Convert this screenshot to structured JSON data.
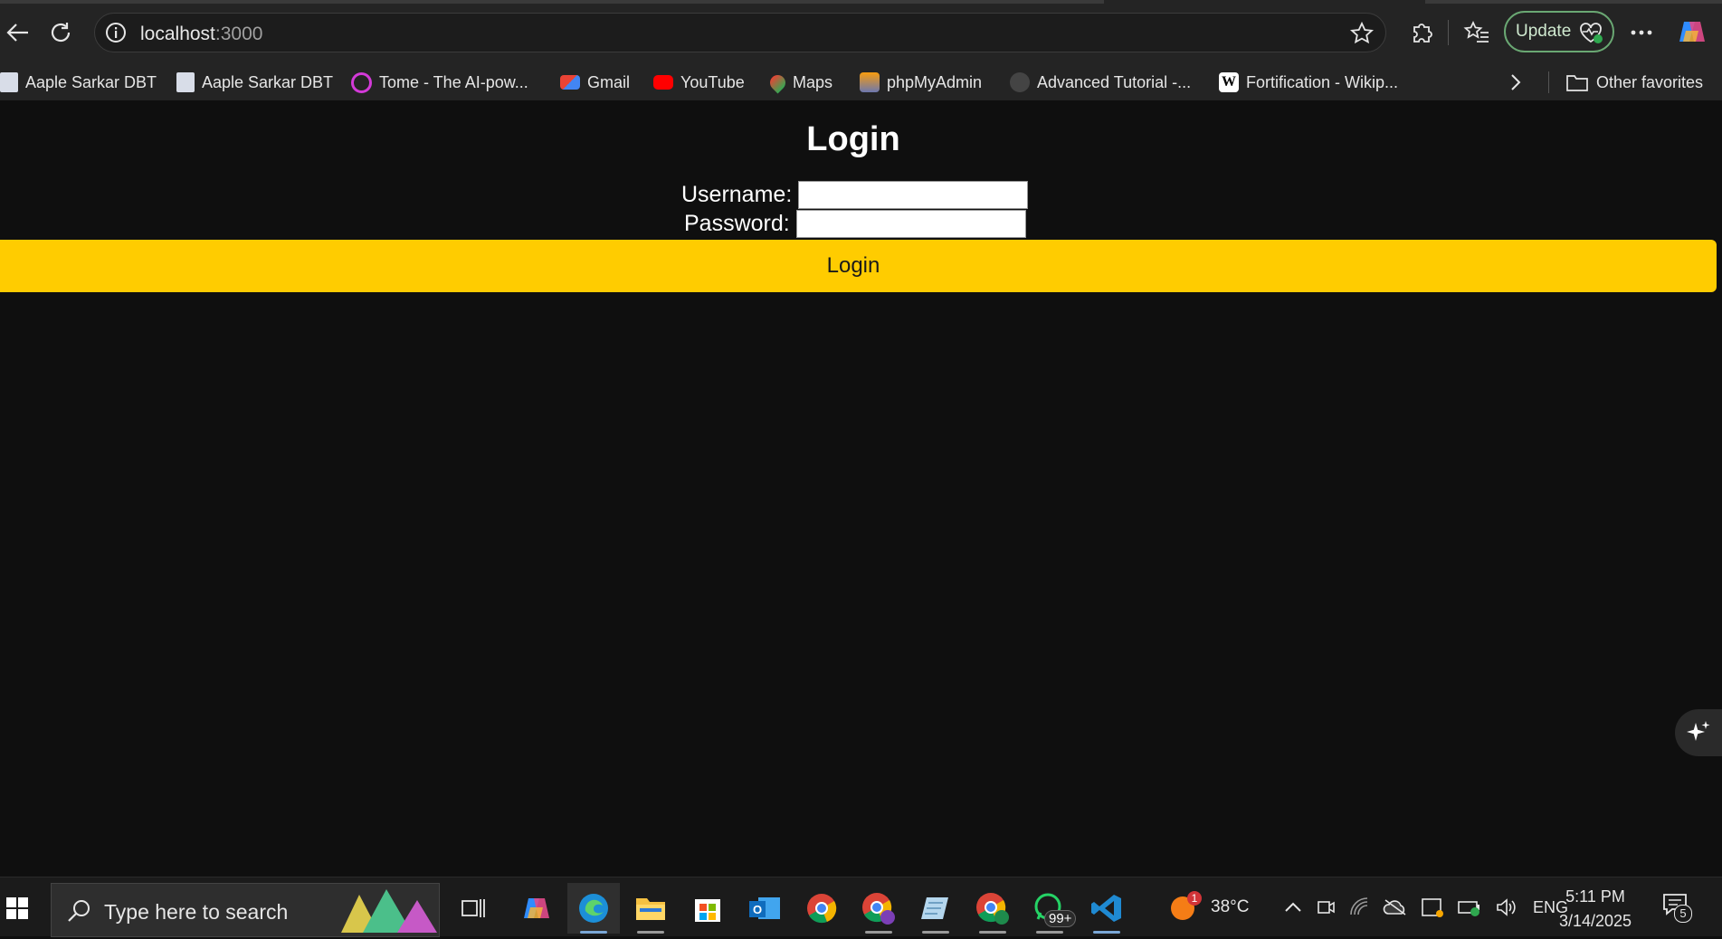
{
  "browser": {
    "url_host": "localhost",
    "url_port": ":3000",
    "update_label": "Update",
    "bookmarks": [
      {
        "label": "Aaple Sarkar DBT",
        "icon": "document-icon"
      },
      {
        "label": "Aaple Sarkar DBT",
        "icon": "document-icon"
      },
      {
        "label": "Tome - The AI-pow...",
        "icon": "tome-icon"
      },
      {
        "label": "Gmail",
        "icon": "gmail-icon"
      },
      {
        "label": "YouTube",
        "icon": "youtube-icon"
      },
      {
        "label": "Maps",
        "icon": "maps-icon"
      },
      {
        "label": "phpMyAdmin",
        "icon": "phpmyadmin-icon"
      },
      {
        "label": "Advanced Tutorial -...",
        "icon": "tutorial-icon"
      },
      {
        "label": "Fortification - Wikip...",
        "icon": "wikipedia-icon"
      }
    ],
    "other_favorites": "Other favorites"
  },
  "page": {
    "title": "Login",
    "username_label": "Username:",
    "password_label": "Password:",
    "login_button": "Login"
  },
  "taskbar": {
    "search_placeholder": "Type here to search",
    "whatsapp_badge": "99+",
    "weather_temp": "38°C",
    "weather_badge": "1",
    "language": "ENG",
    "time": "5:11 PM",
    "date": "3/14/2025",
    "notifications_count": "5"
  },
  "colors": {
    "accent_button": "#ffcc00",
    "page_background": "#0f0f0f",
    "chrome_background": "#242424"
  }
}
